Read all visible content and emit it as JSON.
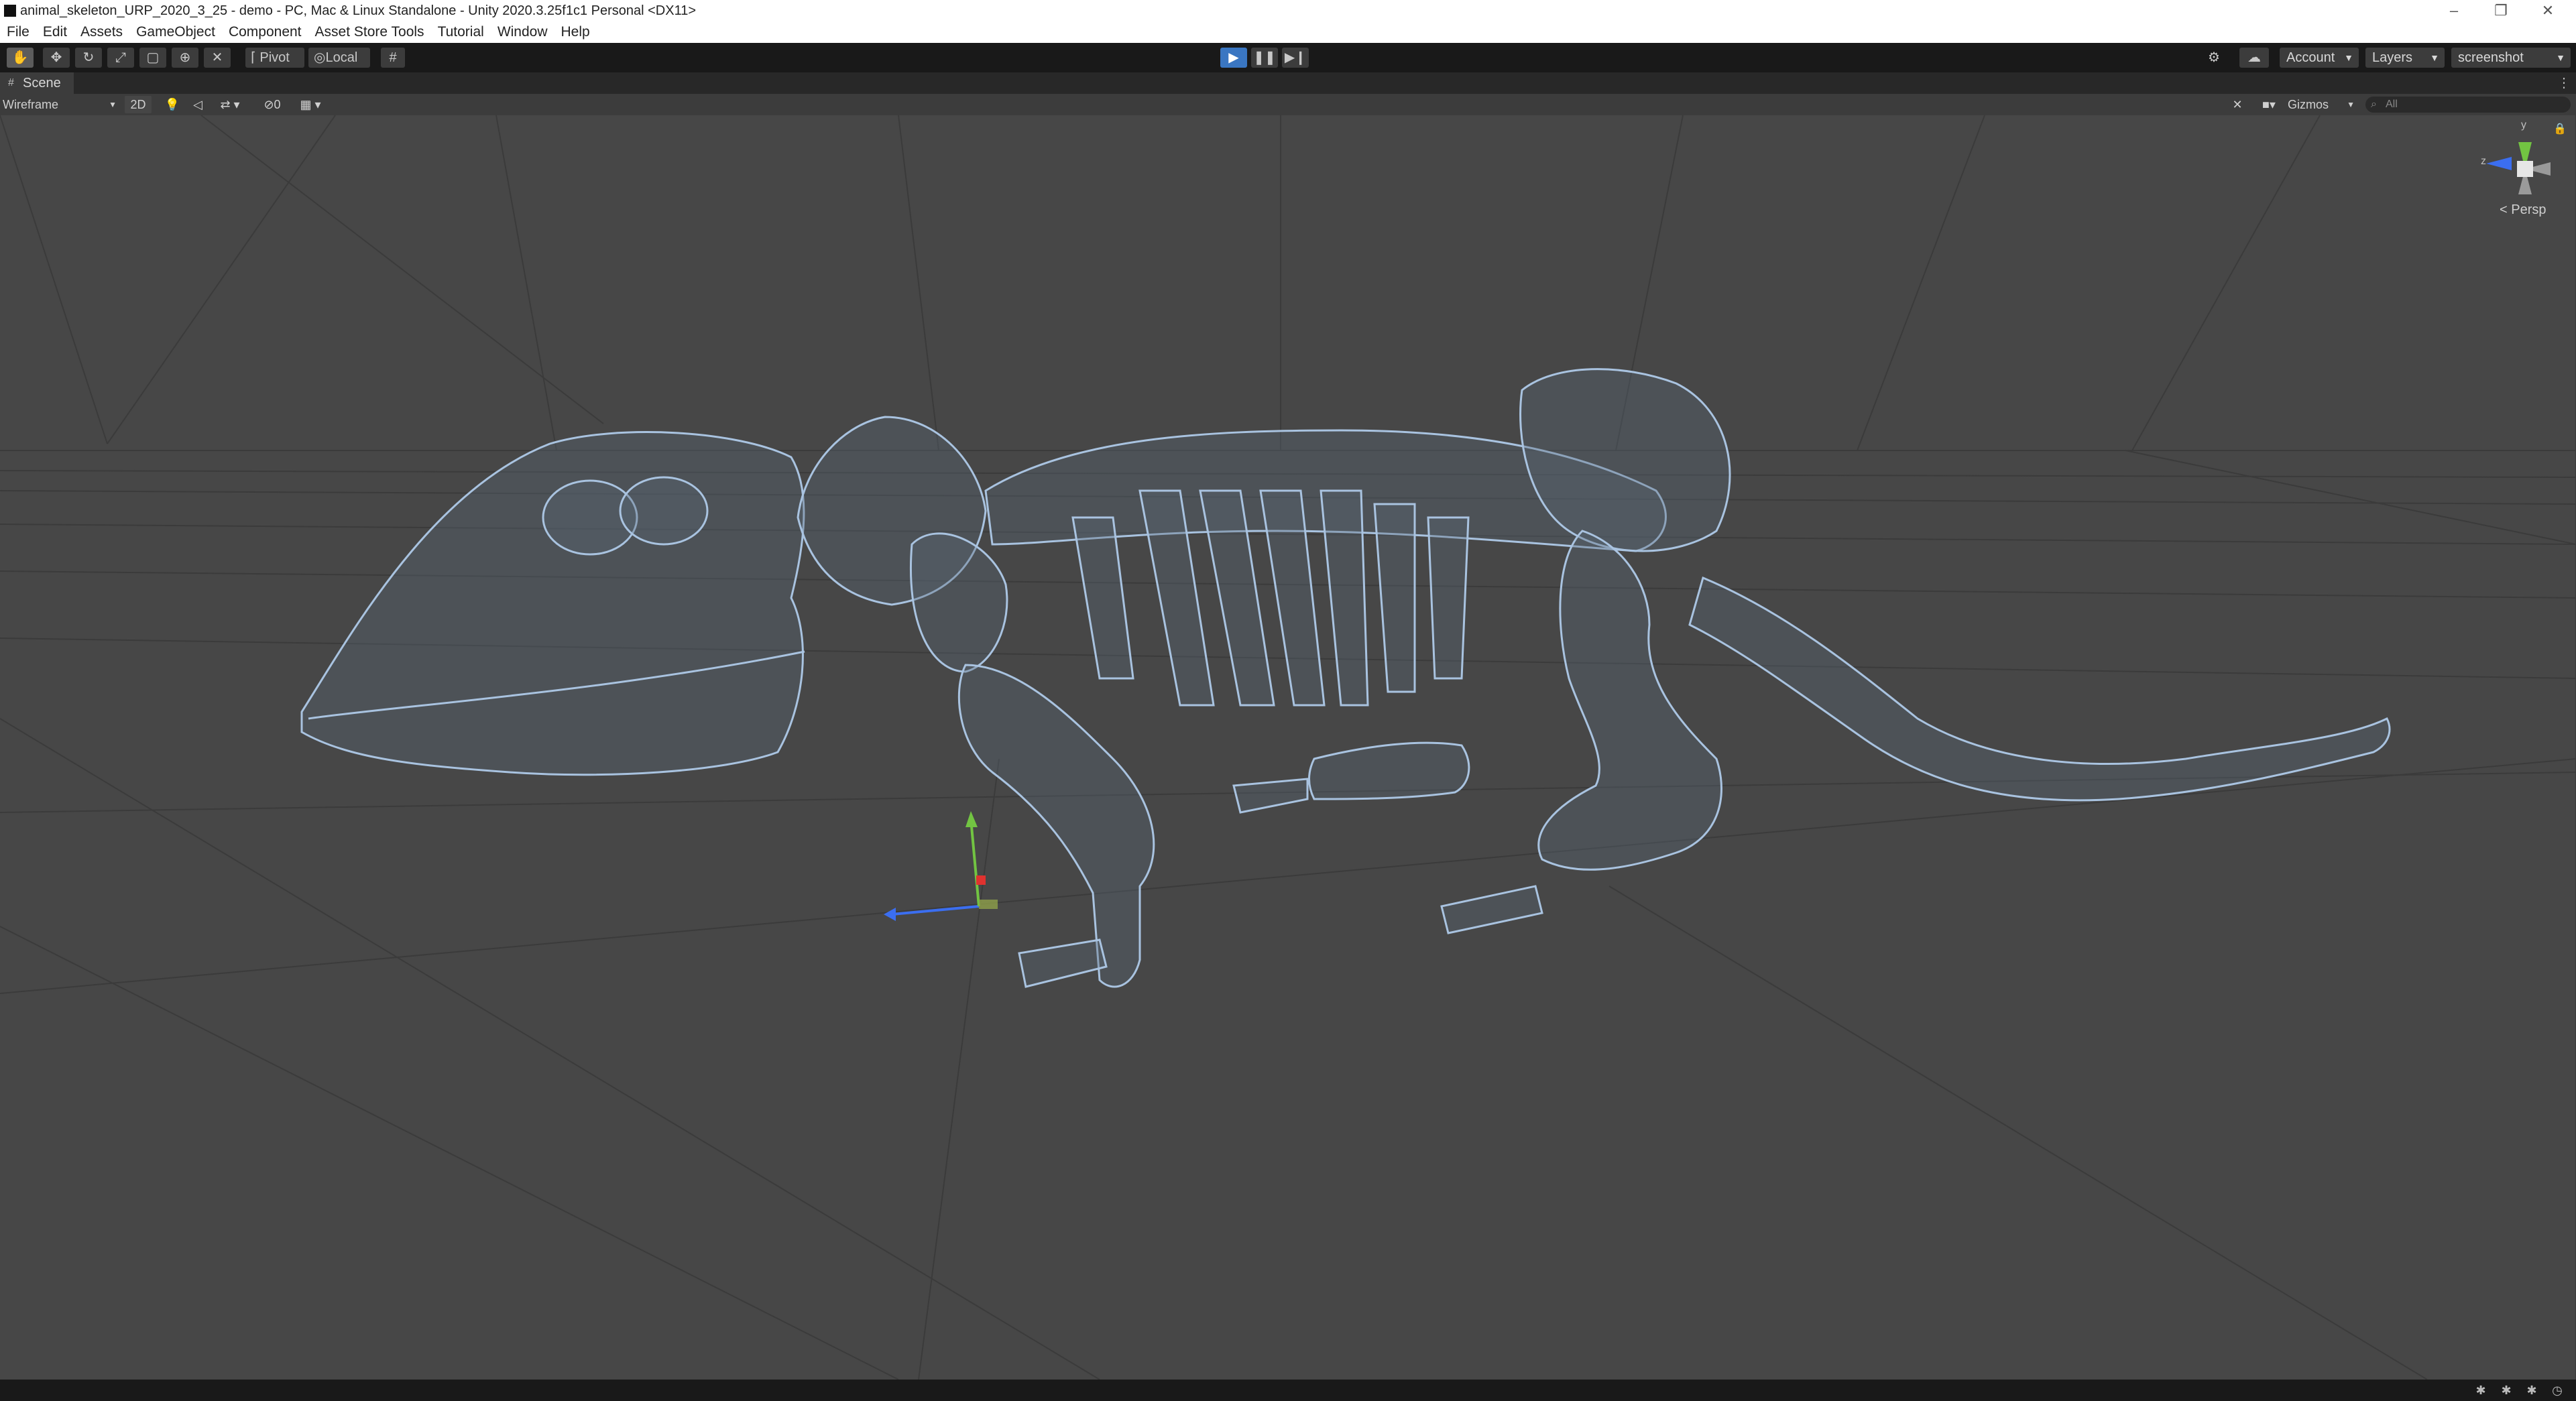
{
  "window": {
    "title": "animal_skeleton_URP_2020_3_25 - demo - PC, Mac & Linux Standalone - Unity 2020.3.25f1c1 Personal <DX11>",
    "minimize_glyph": "–",
    "maximize_glyph": "❐",
    "close_glyph": "✕"
  },
  "menu": {
    "items": [
      "File",
      "Edit",
      "Assets",
      "GameObject",
      "Component",
      "Asset Store Tools",
      "Tutorial",
      "Window",
      "Help"
    ]
  },
  "toolbar": {
    "transform_tools": [
      {
        "name": "hand-tool",
        "glyph": "✋"
      },
      {
        "name": "move-tool",
        "glyph": "✥"
      },
      {
        "name": "rotate-tool",
        "glyph": "↻"
      },
      {
        "name": "scale-tool",
        "glyph": "⤢"
      },
      {
        "name": "rect-tool",
        "glyph": "▢"
      },
      {
        "name": "transform-tool",
        "glyph": "⊕"
      },
      {
        "name": "custom-tool",
        "glyph": "✕"
      }
    ],
    "pivot_label": "Pivot",
    "local_label": "Local",
    "account_label": "Account",
    "layers_label": "Layers",
    "layout_label": "screenshot"
  },
  "scene": {
    "tab_label": "Scene",
    "draw_mode": "Wireframe",
    "toggle_2d": "2D",
    "hidden_count": "0",
    "gizmos_label": "Gizmos",
    "search_placeholder": "All",
    "projection_label": "< Persp",
    "axis_y": "y",
    "axis_z": "z"
  },
  "colors": {
    "background": "#474747",
    "wireframe": "#a9c3e0",
    "play_active": "#3a76c2",
    "gizmo_x": "#e0322f",
    "gizmo_y": "#72c442",
    "gizmo_z": "#3b6ef0"
  }
}
